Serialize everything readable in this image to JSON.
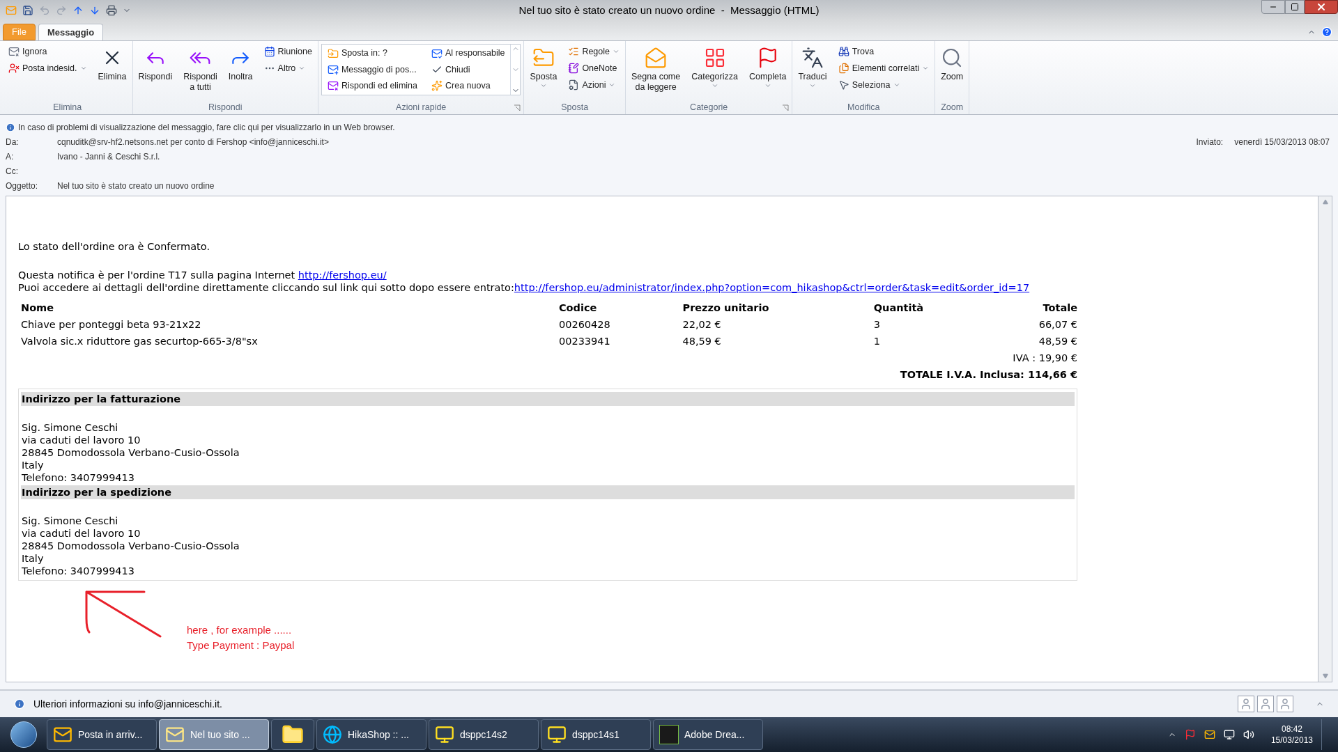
{
  "window": {
    "title": "Nel tuo sito è stato creato un nuovo ordine  -  Messaggio (HTML)"
  },
  "tabs": [
    {
      "label": "File",
      "selected": false
    },
    {
      "label": "Messaggio",
      "selected": true
    }
  ],
  "ribbon": {
    "groups": [
      {
        "label": "Elimina",
        "kind": "buttons",
        "launcher": false,
        "columns": [
          [
            {
              "kind": "small",
              "label": "Ignora",
              "dropdown": false
            },
            {
              "kind": "small",
              "label": "Posta indesid.",
              "dropdown": true
            }
          ],
          [
            {
              "kind": "large",
              "label": "Elimina",
              "dropdown": false
            }
          ]
        ]
      },
      {
        "label": "Rispondi",
        "kind": "buttons",
        "launcher": false,
        "columns": [
          [
            {
              "kind": "large",
              "label": "Rispondi",
              "dropdown": false
            }
          ],
          [
            {
              "kind": "large",
              "label": "Rispondi\na tutti",
              "dropdown": false
            }
          ],
          [
            {
              "kind": "large",
              "label": "Inoltra",
              "dropdown": false
            }
          ],
          [
            {
              "kind": "small",
              "label": "Riunione",
              "dropdown": false
            },
            {
              "kind": "small",
              "label": "Altro",
              "dropdown": true
            }
          ]
        ]
      },
      {
        "label": "Azioni rapide",
        "kind": "gallery",
        "launcher": true,
        "columns": [
          [
            {
              "kind": "small",
              "label": "Sposta in: ?",
              "dropdown": false
            },
            {
              "kind": "small",
              "label": "Messaggio di pos...",
              "dropdown": false
            },
            {
              "kind": "small",
              "label": "Rispondi ed elimina",
              "dropdown": false
            }
          ],
          [
            {
              "kind": "small",
              "label": "Al responsabile",
              "dropdown": false
            },
            {
              "kind": "small",
              "label": "Chiudi",
              "dropdown": false
            },
            {
              "kind": "small",
              "label": "Crea nuova",
              "dropdown": false
            }
          ]
        ]
      },
      {
        "label": "Sposta",
        "kind": "buttons",
        "launcher": false,
        "columns": [
          [
            {
              "kind": "large",
              "label": "Sposta",
              "dropdown": true
            }
          ],
          [
            {
              "kind": "small",
              "label": "Regole",
              "dropdown": true
            },
            {
              "kind": "small",
              "label": "OneNote",
              "dropdown": false
            },
            {
              "kind": "small",
              "label": "Azioni",
              "dropdown": true
            }
          ]
        ]
      },
      {
        "label": "Categorie",
        "kind": "buttons",
        "launcher": true,
        "columns": [
          [
            {
              "kind": "large",
              "label": "Segna come\nda leggere",
              "dropdown": false
            }
          ],
          [
            {
              "kind": "large",
              "label": "Categorizza",
              "dropdown": true
            }
          ],
          [
            {
              "kind": "large",
              "label": "Completa",
              "dropdown": true
            }
          ]
        ]
      },
      {
        "label": "Modifica",
        "kind": "buttons",
        "launcher": false,
        "columns": [
          [
            {
              "kind": "large",
              "label": "Traduci",
              "dropdown": true
            }
          ],
          [
            {
              "kind": "small",
              "label": "Trova",
              "dropdown": false
            },
            {
              "kind": "small",
              "label": "Elementi correlati",
              "dropdown": true
            },
            {
              "kind": "small",
              "label": "Seleziona",
              "dropdown": true
            }
          ]
        ]
      },
      {
        "label": "Zoom",
        "kind": "buttons",
        "launcher": false,
        "columns": [
          [
            {
              "kind": "large",
              "label": "Zoom",
              "dropdown": false
            }
          ]
        ]
      }
    ]
  },
  "info_bar": "In caso di problemi di visualizzazione del messaggio, fare clic qui per visualizzarlo in un Web browser.",
  "header": {
    "fields": [
      {
        "label": "Da:",
        "value": "cqnuditk@srv-hf2.netsons.net per conto di Fershop <info@janniceschi.it>"
      },
      {
        "label": "A:",
        "value": "Ivano - Janni & Ceschi  S.r.l."
      },
      {
        "label": "Cc:"
      },
      {
        "label": "Oggetto:",
        "value": "Nel tuo sito è stato creato un nuovo ordine"
      }
    ],
    "sent": {
      "label": "Inviato:",
      "value": "venerdì 15/03/2013 08:07"
    }
  },
  "body": {
    "status_line": "Lo stato dell'ordine ora è Confermato.",
    "links": [
      {
        "text": "Questa notifica è per l'ordine T17 sulla pagina Internet ",
        "link": "http://fershop.eu/"
      },
      {
        "text": "Puoi accedere ai dettagli dell'ordine direttamente cliccando sul link qui sotto dopo essere entrato:",
        "link": "http://fershop.eu/administrator/index.php?option=com_hikashop&ctrl=order&task=edit&order_id=17"
      }
    ],
    "table": {
      "columns": [
        "Nome",
        "Codice",
        "Prezzo unitario",
        "Quantità",
        "Totale"
      ],
      "rows": [
        [
          "Chiave per ponteggi beta 93-21x22",
          "00260428",
          "22,02 €",
          "3",
          "66,07 €"
        ],
        [
          "Valvola sic.x riduttore gas securtop-665-3/8\"sx",
          "00233941",
          "48,59 €",
          "1",
          "48,59 €"
        ]
      ],
      "tax": "IVA : 19,90 €",
      "total": "TOTALE I.V.A. Inclusa: 114,66 €"
    },
    "addresses": [
      {
        "heading": "Indirizzo per la fatturazione",
        "lines": [
          "Sig. Simone Ceschi",
          "via caduti del lavoro 10",
          "28845 Domodossola Verbano-Cusio-Ossola",
          "Italy",
          "Telefono: 3407999413"
        ]
      },
      {
        "heading": "Indirizzo per la spedizione",
        "lines": [
          "Sig. Simone Ceschi",
          "via caduti del lavoro 10",
          "28845 Domodossola Verbano-Cusio-Ossola",
          "Italy",
          "Telefono: 3407999413"
        ]
      }
    ],
    "annotation": [
      "here , for example ......",
      "Type Payment : Paypal"
    ]
  },
  "status_bar": "Ulteriori informazioni su info@janniceschi.it.",
  "taskbar": {
    "items": [
      {
        "label": "Posta in arriv...",
        "selected": false
      },
      {
        "label": "Nel tuo sito ...",
        "selected": true
      },
      {
        "selected": false
      },
      {
        "label": "HikaShop :: ...",
        "selected": false
      },
      {
        "label": "dsppc14s2",
        "selected": false
      },
      {
        "label": "dsppc14s1",
        "selected": false
      },
      {
        "label": "Adobe Drea...",
        "selected": false
      }
    ],
    "time": "08:42",
    "date": "15/03/2013"
  }
}
